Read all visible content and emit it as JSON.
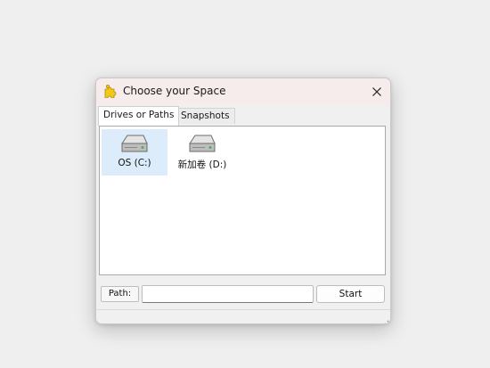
{
  "window": {
    "title": "Choose your Space",
    "close_icon": "close-icon",
    "app_icon": "puzzle-icon"
  },
  "tabs": [
    {
      "label": "Drives or Paths",
      "active": true
    },
    {
      "label": "Snapshots",
      "active": false
    }
  ],
  "drives": [
    {
      "label": "OS (C:)",
      "selected": true,
      "icon": "hard-drive-icon"
    },
    {
      "label": "新加卷 (D:)",
      "selected": false,
      "icon": "hard-drive-icon"
    }
  ],
  "bottom_bar": {
    "path_label": "Path:",
    "path_value": "",
    "start_label": "Start"
  },
  "colors": {
    "titlebar": "#f6ecec",
    "selection": "#dcecfa",
    "icon_yellow": "#f2c81a"
  }
}
